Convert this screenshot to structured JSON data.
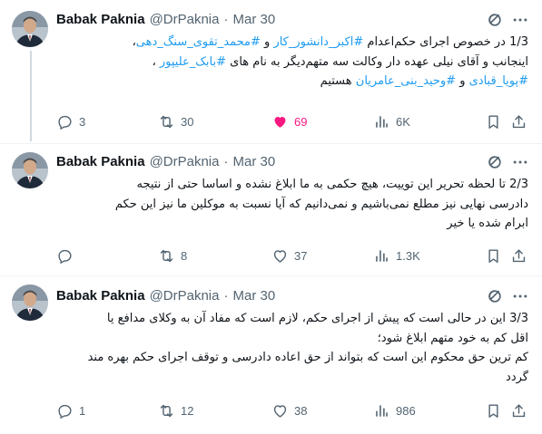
{
  "colors": {
    "hashtag": "#1d9bf0",
    "muted": "#536471",
    "liked": "#f91880"
  },
  "tweets": [
    {
      "name": "Babak Paknia",
      "handle": "@DrPaknia",
      "dot": "·",
      "date": "Mar 30",
      "lines": [
        [
          {
            "t": "1/3 در خصوص اجرای حکم‌اعدام "
          },
          {
            "t": "#اکبر_دانشور_کار",
            "h": true
          },
          {
            "t": " و "
          },
          {
            "t": "#محمد_تقوی_سنگ_دهی",
            "h": true
          },
          {
            "t": "،"
          }
        ],
        [
          {
            "t": "اینجانب و آقای نیلی عهده دار وکالت سه متهم‌دیگر به نام های "
          },
          {
            "t": "#بابک_علیپور",
            "h": true
          },
          {
            "t": " ،"
          }
        ],
        [
          {
            "t": "#پویا_قبادی",
            "h": true
          },
          {
            "t": " و "
          },
          {
            "t": "#وحید_بنی_عامریان",
            "h": true
          },
          {
            "t": " هستیم"
          }
        ]
      ],
      "stats": {
        "replies": "3",
        "retweets": "30",
        "likes": "69",
        "views": "6K"
      },
      "liked": true
    },
    {
      "name": "Babak Paknia",
      "handle": "@DrPaknia",
      "dot": "·",
      "date": "Mar 30",
      "lines": [
        [
          {
            "t": "2/3 تا لحظه تحریر این توییت، هیچ حکمی به ما ابلاغ نشده و اساسا حتی از نتیجه"
          }
        ],
        [
          {
            "t": "دادرسی نهایی نیز مطلع نمی‌باشیم و نمی‌دانیم که آیا نسبت به موکلین ما نیز این حکم"
          }
        ],
        [
          {
            "t": "ابرام شده یا خیر"
          }
        ]
      ],
      "stats": {
        "replies": "",
        "retweets": "8",
        "likes": "37",
        "views": "1.3K"
      },
      "liked": false
    },
    {
      "name": "Babak Paknia",
      "handle": "@DrPaknia",
      "dot": "·",
      "date": "Mar 30",
      "lines": [
        [
          {
            "t": "3/3 این در حالی است که پیش از اجرای حکم، لازم است که مفاد آن به وکلای مدافع یا"
          }
        ],
        [
          {
            "t": "اقل کم به خود متهم ابلاغ شود؛"
          }
        ],
        [
          {
            "t": "کم ترین حق محکوم این است که بتواند از حق اعاده دادرسی و توقف اجرای حکم بهره مند"
          }
        ],
        [
          {
            "t": "گردد"
          }
        ]
      ],
      "stats": {
        "replies": "1",
        "retweets": "12",
        "likes": "38",
        "views": "986"
      },
      "liked": false
    }
  ],
  "icons": {
    "grok": "grok-icon",
    "more": "more-icon",
    "reply": "reply-icon",
    "retweet": "retweet-icon",
    "like": "like-icon",
    "views": "views-icon",
    "bookmark": "bookmark-icon",
    "share": "share-icon"
  }
}
